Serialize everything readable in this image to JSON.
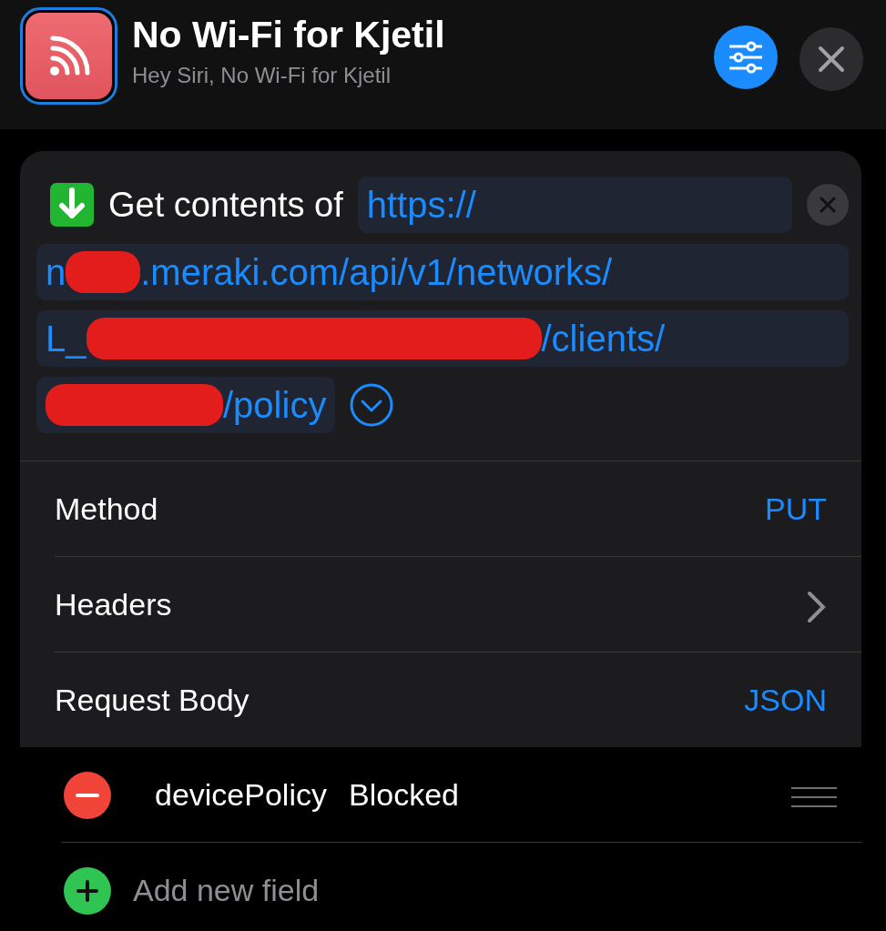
{
  "shortcut": {
    "title": "No Wi-Fi for Kjetil",
    "subtitle": "Hey Siri, No Wi-Fi for Kjetil"
  },
  "action": {
    "label": "Get contents of",
    "url_lines": [
      {
        "parts": [
          {
            "kind": "text",
            "text": "https://"
          }
        ]
      },
      {
        "parts": [
          {
            "kind": "text",
            "text": "n"
          },
          {
            "kind": "redaction"
          },
          {
            "kind": "text",
            "text": ".meraki.com/api/v1/networks/"
          }
        ]
      },
      {
        "parts": [
          {
            "kind": "text",
            "text": "L_"
          },
          {
            "kind": "redaction"
          },
          {
            "kind": "text",
            "text": "/clients/"
          }
        ]
      },
      {
        "parts": [
          {
            "kind": "redaction"
          },
          {
            "kind": "text",
            "text": "/policy"
          }
        ]
      }
    ]
  },
  "parameters": [
    {
      "label": "Method",
      "kind": "value",
      "value": "PUT"
    },
    {
      "label": "Headers",
      "kind": "disclosure"
    },
    {
      "label": "Request Body",
      "kind": "value",
      "value": "JSON"
    }
  ],
  "fields": [
    {
      "key": "devicePolicy",
      "value": "Blocked"
    }
  ],
  "add_field": {
    "label": "Add new field"
  }
}
